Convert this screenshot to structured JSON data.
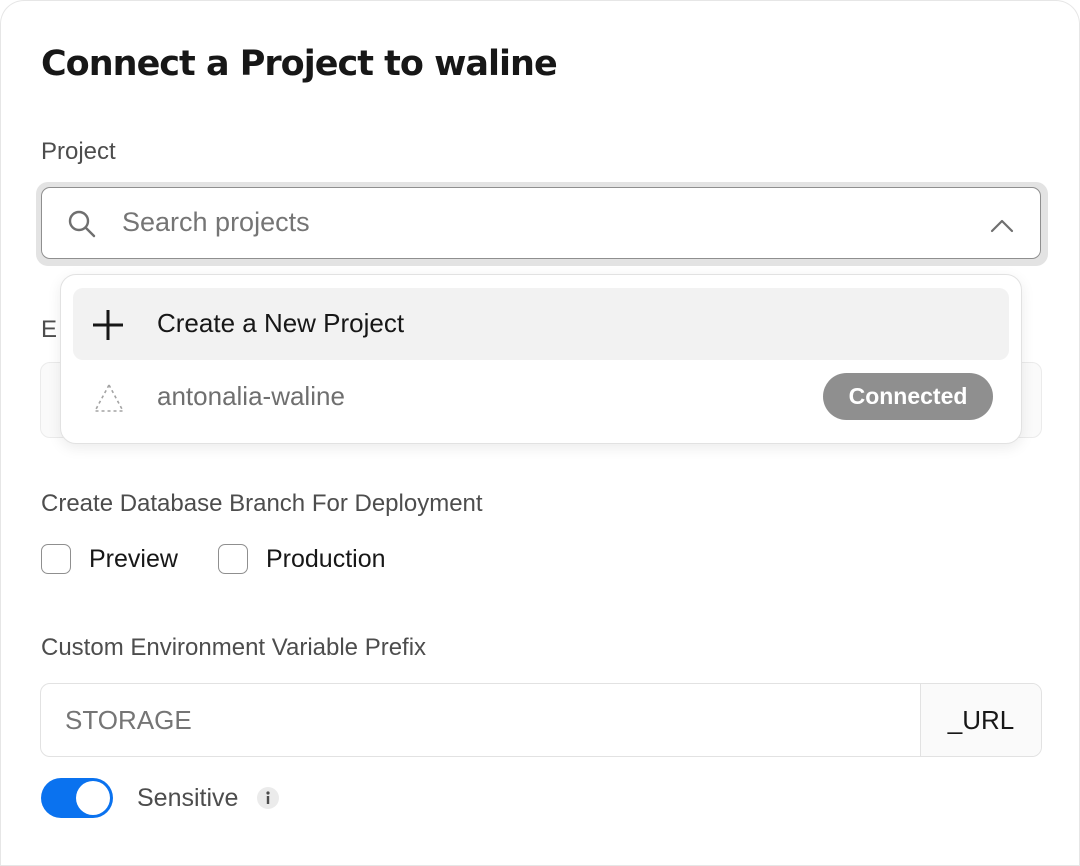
{
  "modal": {
    "title": "Connect a Project to waline"
  },
  "project_field": {
    "label": "Project",
    "search_placeholder": "Search projects"
  },
  "hidden_field": {
    "label_visible": "E"
  },
  "dropdown": {
    "create_option": "Create a New Project",
    "projects": [
      {
        "name": "antonalia-waline",
        "badge": "Connected"
      }
    ]
  },
  "branch": {
    "label": "Create Database Branch For Deployment",
    "options": [
      {
        "label": "Preview",
        "checked": false
      },
      {
        "label": "Production",
        "checked": false
      }
    ]
  },
  "prefix": {
    "label": "Custom Environment Variable Prefix",
    "placeholder": "STORAGE",
    "suffix": "_URL"
  },
  "sensitive": {
    "label": "Sensitive",
    "enabled": true
  },
  "colors": {
    "accent": "#0a72ef",
    "badge_bg": "#8f8f8f"
  }
}
